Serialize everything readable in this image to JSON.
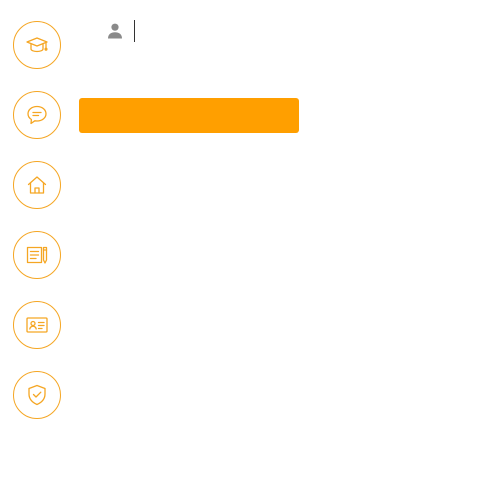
{
  "colors": {
    "accent": "#f5a623",
    "primary_button": "#ff9f00",
    "user_icon": "#8a8a8a"
  },
  "sidebar": {
    "items": [
      {
        "icon": "graduation-cap-icon"
      },
      {
        "icon": "chat-bubble-icon"
      },
      {
        "icon": "home-icon"
      },
      {
        "icon": "document-pencil-icon"
      },
      {
        "icon": "id-card-icon"
      },
      {
        "icon": "shield-check-icon"
      }
    ]
  },
  "login": {
    "user_icon": "user-icon",
    "username_value": "",
    "username_placeholder": "",
    "submit_label": ""
  }
}
